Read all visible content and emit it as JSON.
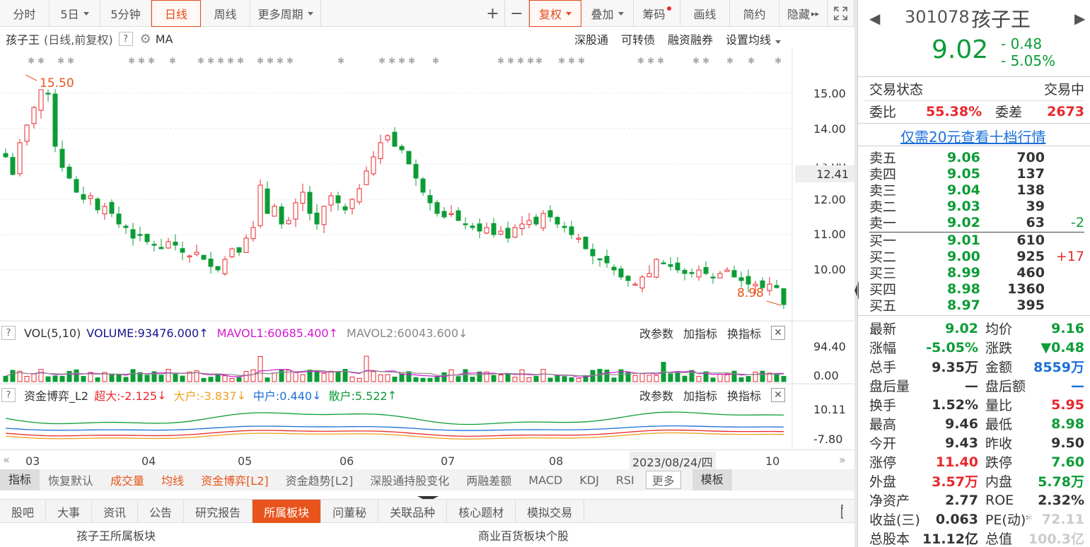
{
  "toolbar": {
    "items": [
      "分时",
      "5日",
      "5分钟",
      "日线",
      "周线",
      "更多周期",
      "+",
      "−",
      "复权",
      "叠加",
      "筹码",
      "画线",
      "简约",
      "隐藏"
    ]
  },
  "title": {
    "name": "孩子王",
    "mode": "(日线,前复权)",
    "ma": "MA"
  },
  "top_links": [
    "深股通",
    "可转债",
    "融资融券",
    "设置均线"
  ],
  "price_labels": {
    "high": "15.50",
    "low": "8.98",
    "current": "12.41"
  },
  "vol_head": {
    "title": "VOL(5,10)",
    "volume": "VOLUME:93476.000",
    "mavol1": "MAVOL1:60685.400",
    "mavol2": "MAVOL2:60043.600"
  },
  "fund_head": {
    "title": "资金博弈_L2",
    "super": "超大:-2.125",
    "large": "大户:-3.837",
    "mid": "中户:0.440",
    "retail": "散户:5.522"
  },
  "ind_buttons": [
    "改参数",
    "加指标",
    "换指标"
  ],
  "xaxis": {
    "months": [
      "03",
      "04",
      "05",
      "06",
      "07",
      "08",
      "10"
    ],
    "cursor_date": "2023/08/24/四"
  },
  "indicator_tabs": [
    "指标",
    "恢复默认",
    "成交量",
    "均线",
    "资金博弈[L2]",
    "资金趋势[L2]",
    "深股通持股变化",
    "两融差额",
    "MACD",
    "KDJ",
    "RSI",
    "更多",
    "模板"
  ],
  "bottom_tabs": [
    "股吧",
    "大事",
    "资讯",
    "公告",
    "研究报告",
    "所属板块",
    "问董秘",
    "关联品种",
    "核心题材",
    "模拟交易"
  ],
  "footer": {
    "left": "孩子王所属板块",
    "right": "商业百货板块个股"
  },
  "quote": {
    "code": "301078",
    "name": "孩子王",
    "price": "9.02",
    "change": "- 0.48",
    "change_pct": "- 5.05%"
  },
  "status": {
    "label": "交易状态",
    "value": "交易中"
  },
  "ratio": {
    "wb_label": "委比",
    "wb": "55.38%",
    "wc_label": "委差",
    "wc": "2673"
  },
  "promo": "仅需20元查看十档行情",
  "asks": [
    {
      "l": "卖五",
      "p": "9.06",
      "v": "700",
      "d": ""
    },
    {
      "l": "卖四",
      "p": "9.05",
      "v": "137",
      "d": ""
    },
    {
      "l": "卖三",
      "p": "9.04",
      "v": "138",
      "d": ""
    },
    {
      "l": "卖二",
      "p": "9.03",
      "v": "39",
      "d": ""
    },
    {
      "l": "卖一",
      "p": "9.02",
      "v": "63",
      "d": "-2"
    }
  ],
  "bids": [
    {
      "l": "买一",
      "p": "9.01",
      "v": "610",
      "d": ""
    },
    {
      "l": "买二",
      "p": "9.00",
      "v": "925",
      "d": "+17"
    },
    {
      "l": "买三",
      "p": "8.99",
      "v": "460",
      "d": ""
    },
    {
      "l": "买四",
      "p": "8.98",
      "v": "1360",
      "d": ""
    },
    {
      "l": "买五",
      "p": "8.97",
      "v": "395",
      "d": ""
    }
  ],
  "stats": [
    [
      "最新",
      "9.02",
      "均价",
      "9.16"
    ],
    [
      "涨幅",
      "-5.05%",
      "涨跌",
      "▼0.48"
    ],
    [
      "总手",
      "9.35万",
      "金额",
      "8559万"
    ],
    [
      "盘后量",
      "—",
      "盘后额",
      "—"
    ],
    [
      "换手",
      "1.52%",
      "量比",
      "5.95"
    ],
    [
      "最高",
      "9.46",
      "最低",
      "8.98"
    ],
    [
      "今开",
      "9.43",
      "昨收",
      "9.50"
    ],
    [
      "涨停",
      "11.40",
      "跌停",
      "7.60"
    ],
    [
      "外盘",
      "3.57万",
      "内盘",
      "5.78万"
    ],
    [
      "净资产",
      "2.77",
      "ROE",
      "2.32%"
    ],
    [
      "收益(三)",
      "0.063",
      "PE(动)*",
      "72.11"
    ],
    [
      "总股本",
      "11.12亿",
      "总值",
      "100.3亿"
    ]
  ],
  "colors": {
    "up": "#e8282c",
    "down": "#0c9c36",
    "accent": "#e8541c"
  },
  "chart_data": {
    "type": "candlestick",
    "yticks": [
      "15.00",
      "14.00",
      "13.00",
      "12.00",
      "11.00",
      "10.00"
    ],
    "vol_ticks": [
      "94.40",
      "0.00"
    ],
    "fund_ticks": [
      "10.11",
      "-7.80"
    ],
    "closes": [
      13.2,
      12.7,
      13.6,
      14.1,
      14.6,
      15.1,
      15.0,
      13.5,
      12.9,
      12.6,
      12.2,
      12.0,
      12.1,
      11.7,
      11.8,
      11.6,
      11.3,
      11.2,
      10.9,
      11.0,
      10.8,
      10.7,
      10.6,
      10.8,
      10.7,
      10.5,
      10.4,
      10.5,
      10.3,
      10.1,
      10.0,
      10.3,
      10.6,
      10.5,
      10.9,
      11.2,
      12.4,
      11.6,
      11.8,
      11.3,
      11.4,
      11.9,
      12.2,
      11.6,
      11.3,
      11.8,
      12.1,
      11.9,
      11.7,
      12.0,
      12.3,
      12.8,
      13.2,
      13.6,
      13.8,
      13.5,
      13.4,
      13.0,
      12.6,
      12.2,
      11.9,
      11.6,
      11.5,
      11.6,
      11.4,
      11.3,
      11.2,
      11.1,
      11.2,
      11.0,
      11.1,
      10.9,
      11.2,
      11.3,
      11.4,
      11.3,
      11.6,
      11.5,
      11.3,
      11.2,
      11.0,
      10.9,
      10.6,
      10.4,
      10.3,
      10.2,
      10.0,
      9.8,
      9.7,
      9.6,
      9.8,
      9.9,
      10.3,
      10.2,
      10.1,
      10.0,
      9.9,
      9.9,
      10.0,
      9.9,
      9.8,
      9.9,
      10.0,
      9.8,
      9.7,
      9.6,
      9.6,
      9.5,
      9.6,
      9.5,
      9.02
    ]
  }
}
